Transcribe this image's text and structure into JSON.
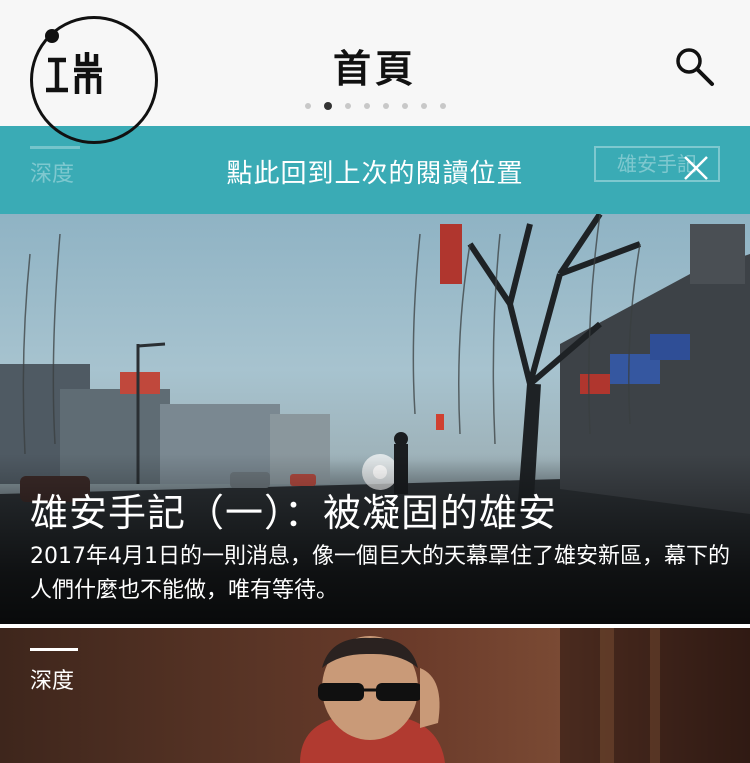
{
  "header": {
    "logo_name": "端",
    "title": "首頁",
    "page_count": 8,
    "active_page": 2
  },
  "banner": {
    "message": "點此回到上次的閱讀位置",
    "bg_left_category": "深度",
    "bg_right_tag": "雄安手記"
  },
  "hero_article": {
    "title": "雄安手記（一）：被凝固的雄安",
    "summary": "2017年4月1日的一則消息，像一個巨大的天幕罩住了雄安新區，幕下的人們什麼也不能做，唯有等待。"
  },
  "next_article": {
    "category": "深度"
  },
  "icons": {
    "search": "search-icon",
    "close": "close-icon"
  },
  "colors": {
    "banner": "#3aabb5",
    "header_bg": "#f7f7f7",
    "active_dot": "#333333"
  }
}
